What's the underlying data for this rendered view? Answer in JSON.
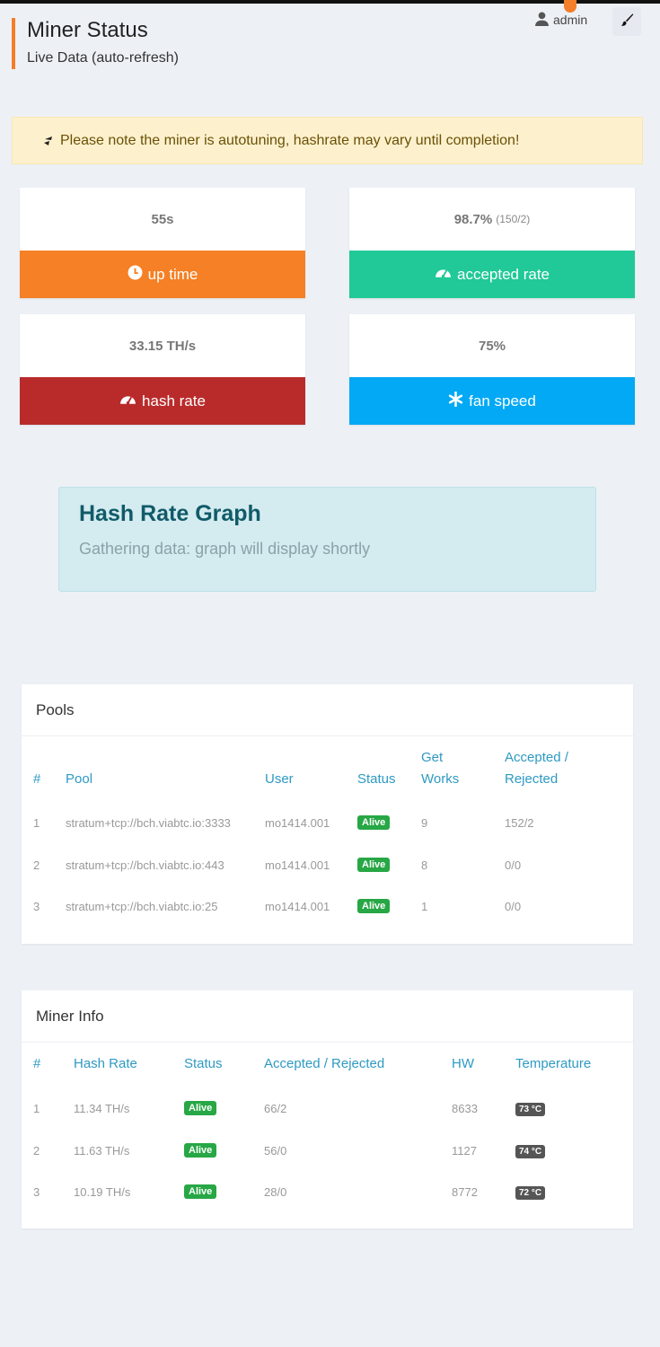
{
  "header": {
    "title": "Miner Status",
    "subtitle": "Live Data (auto-refresh)",
    "user": "admin",
    "user_icon": "user-icon",
    "theme_icon": "brush-icon"
  },
  "alert": {
    "icon": "tuning-icon",
    "text": "Please note the miner is autotuning, hashrate may vary until completion!"
  },
  "stats": {
    "uptime": {
      "value": "55s",
      "label": "up time",
      "icon": "clock-icon",
      "color": "#f58025"
    },
    "accepted": {
      "value": "98.7%",
      "detail": "(150/2)",
      "label": "accepted rate",
      "icon": "dashboard-icon",
      "color": "#20c997"
    },
    "hashrate": {
      "value": "33.15 TH/s",
      "label": "hash rate",
      "icon": "dashboard-icon",
      "color": "#b92b2b"
    },
    "fan": {
      "value": "75%",
      "label": "fan speed",
      "icon": "asterisk-icon",
      "color": "#03a9f4"
    }
  },
  "graph": {
    "title": "Hash Rate Graph",
    "message": "Gathering data: graph will display shortly"
  },
  "pools": {
    "title": "Pools",
    "headers": {
      "num": "#",
      "pool": "Pool",
      "user": "User",
      "status": "Status",
      "works_1": "Get",
      "works_2": "Works",
      "acc_1": "Accepted /",
      "acc_2": "Rejected"
    },
    "rows": [
      {
        "num": "1",
        "pool": "stratum+tcp://bch.viabtc.io:3333",
        "user": "mo1414.001",
        "status": "Alive",
        "works": "9",
        "acc": "152/2"
      },
      {
        "num": "2",
        "pool": "stratum+tcp://bch.viabtc.io:443",
        "user": "mo1414.001",
        "status": "Alive",
        "works": "8",
        "acc": "0/0"
      },
      {
        "num": "3",
        "pool": "stratum+tcp://bch.viabtc.io:25",
        "user": "mo1414.001",
        "status": "Alive",
        "works": "1",
        "acc": "0/0"
      }
    ]
  },
  "miner_info": {
    "title": "Miner Info",
    "headers": {
      "num": "#",
      "hash": "Hash Rate",
      "status": "Status",
      "acc": "Accepted / Rejected",
      "hw": "HW",
      "temp": "Temperature"
    },
    "rows": [
      {
        "num": "1",
        "hash": "11.34 TH/s",
        "status": "Alive",
        "acc": "66/2",
        "hw": "8633",
        "temp": "73 °C"
      },
      {
        "num": "2",
        "hash": "11.63 TH/s",
        "status": "Alive",
        "acc": "56/0",
        "hw": "1127",
        "temp": "74 °C"
      },
      {
        "num": "3",
        "hash": "10.19 TH/s",
        "status": "Alive",
        "acc": "28/0",
        "hw": "8772",
        "temp": "72 °C"
      }
    ]
  }
}
